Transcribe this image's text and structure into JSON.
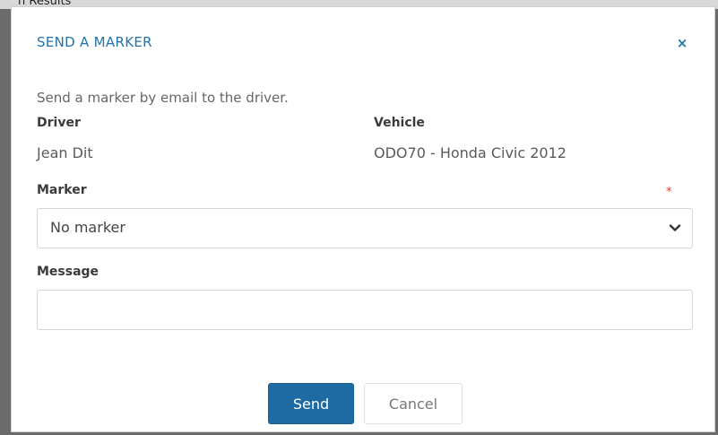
{
  "background": {
    "partial_title": "h Results"
  },
  "modal": {
    "title": "SEND A MARKER",
    "close_glyph": "×",
    "intro": "Send a marker by email to the driver.",
    "driver": {
      "label": "Driver",
      "value": "Jean Dit"
    },
    "vehicle": {
      "label": "Vehicle",
      "value": "ODO70 - Honda Civic 2012"
    },
    "marker": {
      "label": "Marker",
      "required_mark": "*",
      "selected": "No marker"
    },
    "message": {
      "label": "Message",
      "value": ""
    },
    "buttons": {
      "send": "Send",
      "cancel": "Cancel"
    }
  },
  "colors": {
    "accent": "#1f74ad",
    "primary_button": "#1e6aa3",
    "required": "#e0443c"
  }
}
